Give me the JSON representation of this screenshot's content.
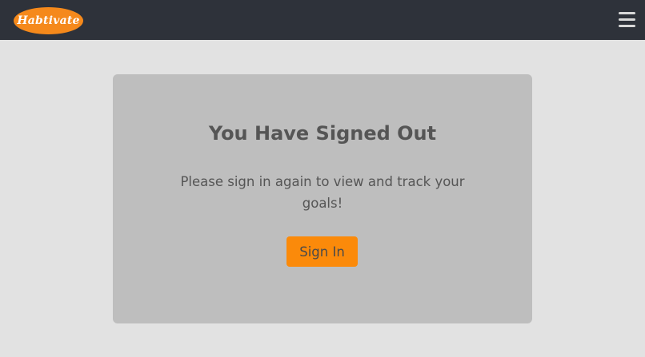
{
  "app": {
    "logo_text": "Habtivate"
  },
  "navbar": {
    "menu_icon": "hamburger-menu-icon"
  },
  "card": {
    "title": "You Have Signed Out",
    "message": "Please sign in again to view and track your goals!",
    "button_label": "Sign In"
  },
  "colors": {
    "navbar": "#2e323a",
    "background": "#e2e2e2",
    "card": "#bebebe",
    "accent": "#fb8a0a",
    "text": "#555555"
  }
}
